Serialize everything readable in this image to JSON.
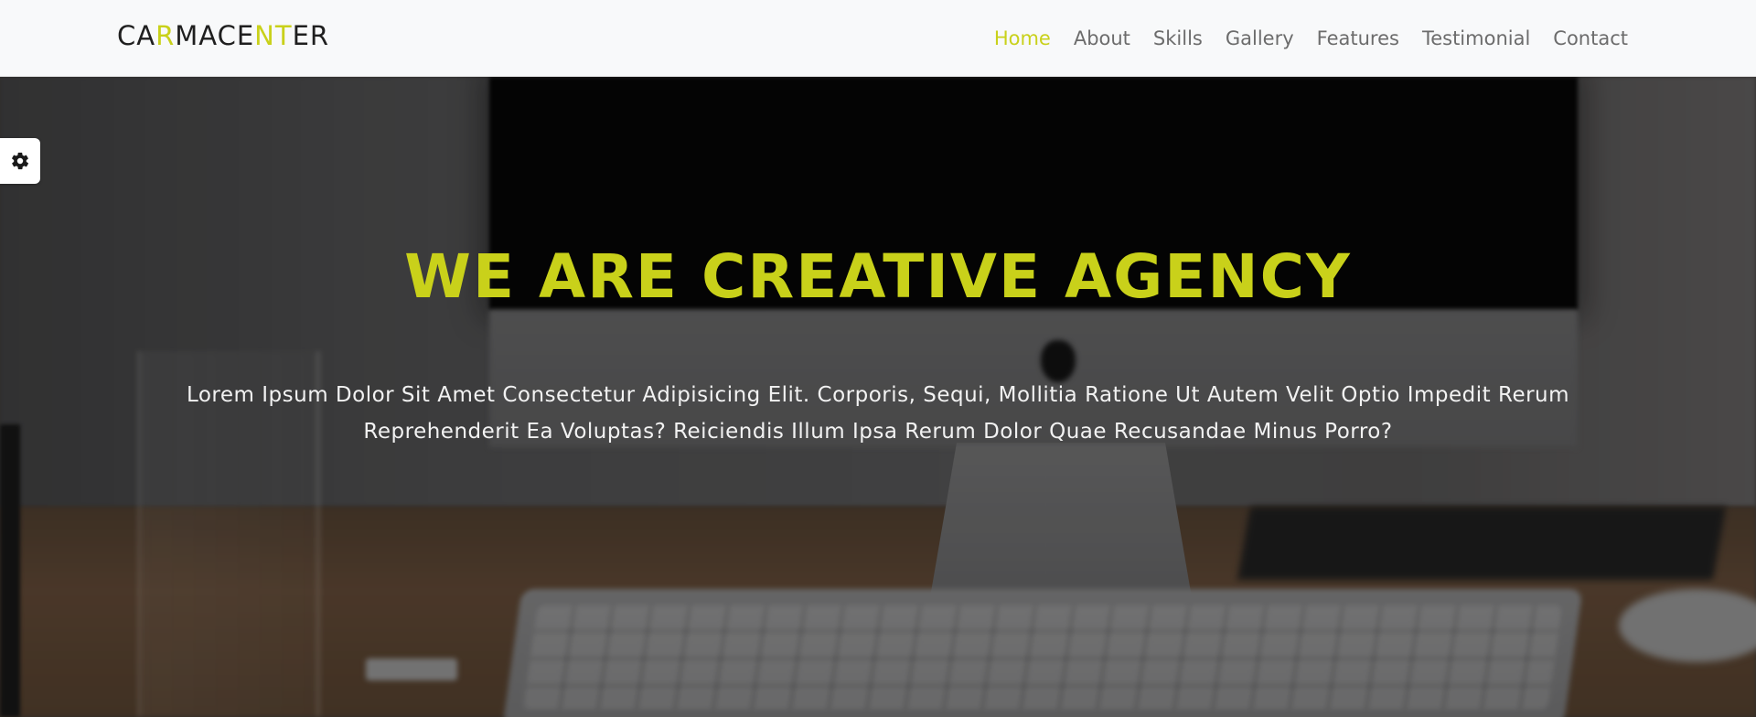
{
  "brand": {
    "parts": [
      {
        "text": "CA",
        "highlight": false
      },
      {
        "text": "R",
        "highlight": true
      },
      {
        "text": "MACE",
        "highlight": false
      },
      {
        "text": "NT",
        "highlight": true
      },
      {
        "text": "ER",
        "highlight": false
      }
    ]
  },
  "nav": {
    "items": [
      {
        "label": "Home",
        "active": true
      },
      {
        "label": "About",
        "active": false
      },
      {
        "label": "Skills",
        "active": false
      },
      {
        "label": "Gallery",
        "active": false
      },
      {
        "label": "Features",
        "active": false
      },
      {
        "label": "Testimonial",
        "active": false
      },
      {
        "label": "Contact",
        "active": false
      }
    ]
  },
  "hero": {
    "title": "WE ARE CREATIVE AGENCY",
    "text": "Lorem Ipsum Dolor Sit Amet Consectetur Adipisicing Elit. Corporis, Sequi, Mollitia Ratione Ut Autem Velit Optio Impedit Rerum Reprehenderit Ea Voluptas? Reiciendis Illum Ipsa Rerum Dolor Quae Recusandae Minus Porro?"
  },
  "settings": {
    "icon": "gear-icon"
  },
  "colors": {
    "accent": "#c9d11a",
    "nav_text": "#6c6c6c",
    "nav_bg": "#f8f9fa",
    "brand_text": "#1f1f1f"
  }
}
